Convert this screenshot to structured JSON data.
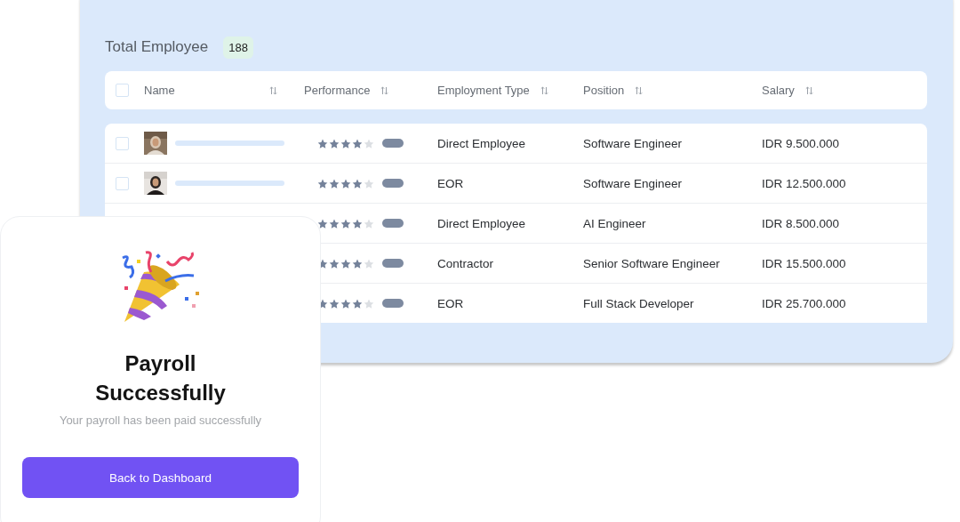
{
  "panel": {
    "title": "Total Employee",
    "count": "188"
  },
  "table": {
    "select_all": {
      "checked": false
    },
    "columns": [
      {
        "label": "Name"
      },
      {
        "label": "Performance"
      },
      {
        "label": "Employment Type"
      },
      {
        "label": "Position"
      },
      {
        "label": "Salary"
      }
    ],
    "rows": [
      {
        "checked": false,
        "stars": 4,
        "employment_type": "Direct Employee",
        "position": "Software Engineer",
        "salary": "IDR 9.500.000"
      },
      {
        "checked": false,
        "stars": 4,
        "employment_type": "EOR",
        "position": "Software Engineer",
        "salary": "IDR 12.500.000"
      },
      {
        "stars": 4,
        "employment_type": "Direct Employee",
        "position": "AI Engineer",
        "salary": "IDR 8.500.000"
      },
      {
        "stars": 4,
        "employment_type": "Contractor",
        "position": "Senior Software Engineer",
        "salary": "IDR 15.500.000"
      },
      {
        "stars": 4,
        "employment_type": "EOR",
        "position": "Full Stack Developer",
        "salary": "IDR 25.700.000"
      }
    ]
  },
  "dialog": {
    "title": "Payroll Successfully",
    "message": "Your payroll has been paid successfully",
    "button": "Back to Dashboard"
  }
}
